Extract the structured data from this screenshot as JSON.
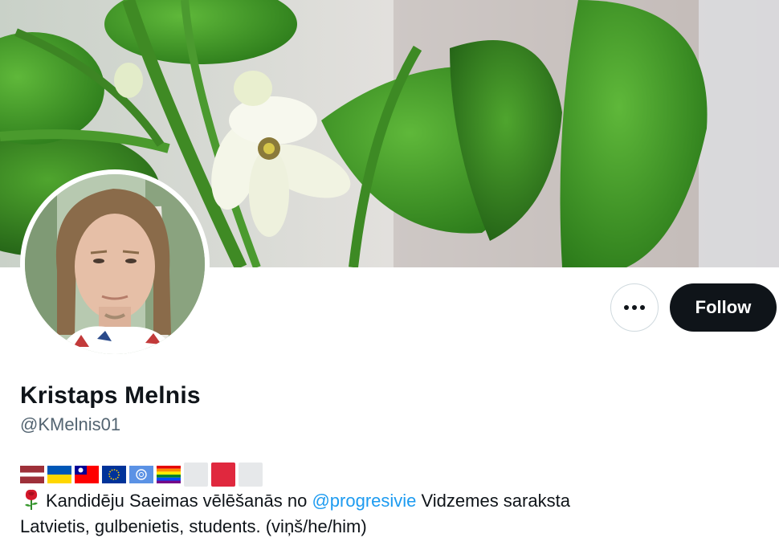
{
  "profile": {
    "display_name": "Kristaps Melnis",
    "handle": "@KMelnis01",
    "follow_label": "Follow",
    "more_icon": "ellipsis-icon",
    "flags": [
      {
        "name": "latvia-flag-icon"
      },
      {
        "name": "ukraine-flag-icon"
      },
      {
        "name": "taiwan-flag-icon"
      },
      {
        "name": "eu-flag-icon"
      },
      {
        "name": "un-flag-icon"
      },
      {
        "name": "rainbow-flag-icon"
      },
      {
        "name": "white-flag-icon"
      },
      {
        "name": "red-flag-icon"
      },
      {
        "name": "white-flag-icon-2"
      }
    ],
    "bio": {
      "line1_prefix": "Kandidēju Saeimas vēlēšanās no ",
      "mention": "@progresivie",
      "line1_suffix": " Vidzemes saraksta",
      "line2": "Latvietis, gulbenietis, students. (viņš/he/him)"
    }
  },
  "colors": {
    "follow_bg": "#0f1419",
    "mention": "#1d9bf0",
    "handle": "#536471"
  }
}
